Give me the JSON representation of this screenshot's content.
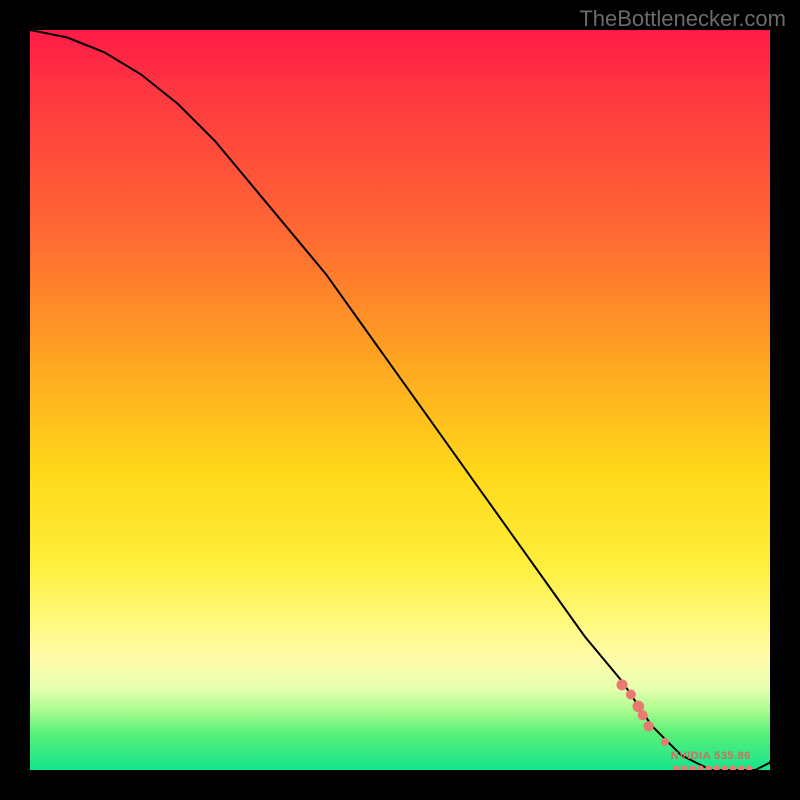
{
  "watermark": "TheBottlenecker.com",
  "colors": {
    "dot": "#e87a72",
    "curve": "#000000"
  },
  "chart_data": {
    "type": "line",
    "title": "",
    "xlabel": "",
    "ylabel": "",
    "xlim": [
      0,
      100
    ],
    "ylim": [
      0,
      100
    ],
    "grid": false,
    "legend": false,
    "series": [
      {
        "name": "bottleneck-curve",
        "x": [
          0,
          5,
          10,
          15,
          20,
          25,
          30,
          35,
          40,
          45,
          50,
          55,
          60,
          65,
          70,
          75,
          80,
          82,
          84,
          86,
          88,
          90,
          92,
          94,
          96,
          98,
          100,
          101,
          102
        ],
        "y": [
          100,
          99,
          97,
          94,
          90,
          85,
          79,
          73,
          67,
          60,
          53,
          46,
          39,
          32,
          25,
          18,
          12,
          9,
          6,
          4,
          2,
          1,
          0,
          0,
          0,
          0,
          1,
          3.5,
          6
        ]
      }
    ],
    "markers": [
      {
        "x": 80,
        "y": 11.5,
        "r": 5.5
      },
      {
        "x": 81.2,
        "y": 10.2,
        "r": 5
      },
      {
        "x": 82.2,
        "y": 8.6,
        "r": 5.8
      },
      {
        "x": 82.8,
        "y": 7.4,
        "r": 5
      },
      {
        "x": 83.6,
        "y": 5.9,
        "r": 5.2
      },
      {
        "x": 85.8,
        "y": 3.8,
        "r": 4.0
      },
      {
        "x": 87.3,
        "y": 0.2,
        "r": 3.2
      },
      {
        "x": 88.4,
        "y": 0.2,
        "r": 3.2
      },
      {
        "x": 89.5,
        "y": 0.2,
        "r": 3.2
      },
      {
        "x": 90.6,
        "y": 0.2,
        "r": 3.2
      },
      {
        "x": 91.7,
        "y": 0.2,
        "r": 3.2
      },
      {
        "x": 92.8,
        "y": 0.2,
        "r": 3.2
      },
      {
        "x": 93.9,
        "y": 0.2,
        "r": 3.2
      },
      {
        "x": 95.0,
        "y": 0.2,
        "r": 3.2
      },
      {
        "x": 96.1,
        "y": 0.2,
        "r": 3.2
      },
      {
        "x": 97.2,
        "y": 0.2,
        "r": 3.2
      },
      {
        "x": 100.5,
        "y": 3.0,
        "r": 4.3
      },
      {
        "x": 101.1,
        "y": 4.1,
        "r": 4.3
      }
    ],
    "series_label": {
      "text": "NVIDIA 535.86",
      "x": 92,
      "y": 1.5
    }
  }
}
